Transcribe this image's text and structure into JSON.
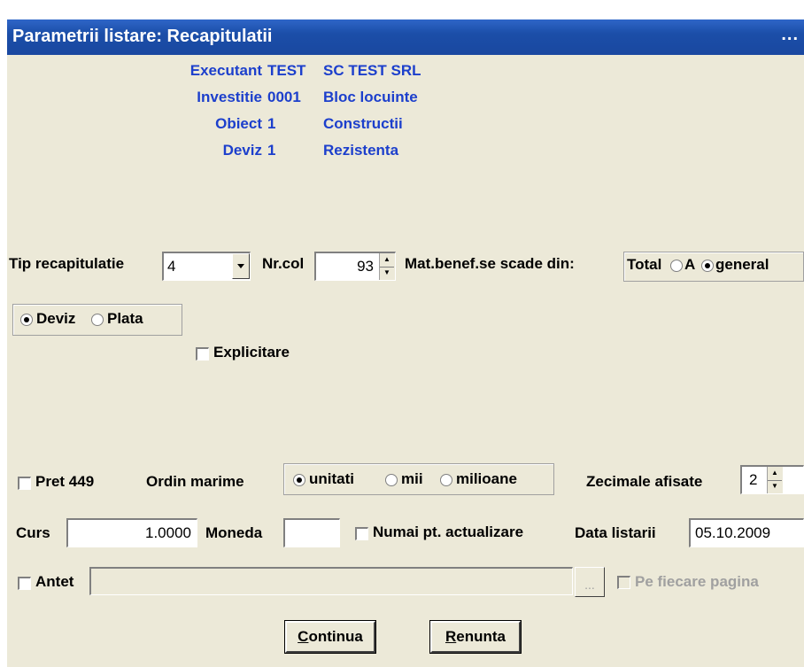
{
  "window": {
    "title": "Parametrii listare: Recapitulatii",
    "title_dots": "..."
  },
  "info": {
    "executant": {
      "label": "Executant",
      "code": "TEST",
      "value": "SC TEST SRL"
    },
    "investitie": {
      "label": "Investitie",
      "code": "0001",
      "value": "Bloc locuinte"
    },
    "obiect": {
      "label": "Obiect",
      "code": "1",
      "value": "Constructii"
    },
    "deviz": {
      "label": "Deviz",
      "code": "1",
      "value": "Rezistenta"
    }
  },
  "tip_recapitulatie": {
    "label": "Tip recapitulatie",
    "value": "4"
  },
  "nr_col": {
    "label": "Nr.col",
    "value": "93"
  },
  "mat_benef": {
    "label": "Mat.benef.se scade din:",
    "group_label": "Total",
    "options": [
      "A",
      "general"
    ],
    "selected": "general"
  },
  "mode": {
    "options": [
      "Deviz",
      "Plata"
    ],
    "selected": "Deviz"
  },
  "explicitare": {
    "label": "Explicitare",
    "checked": false
  },
  "pret": {
    "label": "Pret 449",
    "checked": false
  },
  "ordin_marime": {
    "label": "Ordin marime",
    "options": [
      "unitati",
      "mii",
      "milioane"
    ],
    "selected": "unitati"
  },
  "zecimale": {
    "label": "Zecimale afisate",
    "value": "2"
  },
  "curs": {
    "label": "Curs",
    "value": "1.0000"
  },
  "moneda": {
    "label": "Moneda",
    "value": ""
  },
  "numai_actualizare": {
    "label": "Numai pt. actualizare",
    "checked": false
  },
  "data_listarii": {
    "label": "Data listarii",
    "value": "05.10.2009"
  },
  "antet": {
    "label": "Antet",
    "checked": false,
    "value": "",
    "browse_label": "...",
    "pe_fiecare_label": "Pe fiecare pagina"
  },
  "buttons": {
    "continua": {
      "accel": "C",
      "rest": "ontinua"
    },
    "renunta": {
      "accel": "R",
      "rest": "enunta"
    }
  },
  "colors": {
    "title_bg": "#1b4ea8",
    "dialog_bg": "#ece9d8",
    "info_text": "#1c3fcc"
  }
}
